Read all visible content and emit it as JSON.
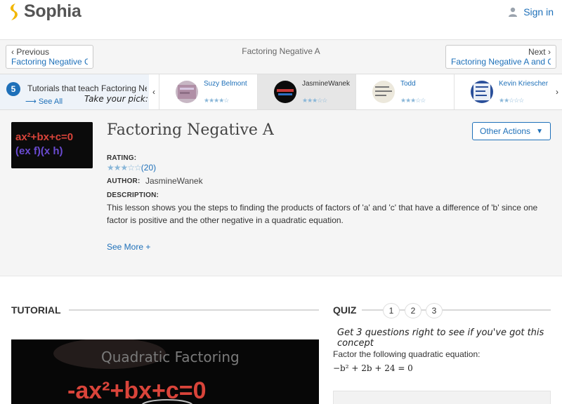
{
  "header": {
    "logo_text": "Sophia",
    "signin_label": "Sign in"
  },
  "navigation": {
    "prev_dir": "Previous",
    "prev_title": "Factoring Negative C",
    "current_title": "Factoring Negative A",
    "next_dir": "Next",
    "next_title": "Factoring Negative A and C"
  },
  "tutorial_strip": {
    "count": "5",
    "label": "Tutorials that teach Factoring Negative A",
    "see_all": "See All",
    "pick_text": "Take your pick:",
    "tutors": [
      {
        "name": "Suzy Belmont",
        "stars": "★★★★☆"
      },
      {
        "name": "JasmineWanek",
        "stars": "★★★☆☆"
      },
      {
        "name": "Todd",
        "stars": "★★★☆☆"
      },
      {
        "name": "Kevin Kriescher",
        "stars": "★★☆☆☆"
      }
    ]
  },
  "lesson": {
    "title": "Factoring Negative A",
    "more_actions": "Other Actions",
    "rating_label": "RATING:",
    "rating_stars": "★★★☆☆",
    "rating_count": "(20)",
    "author_label": "AUTHOR:",
    "author": "JasmineWanek",
    "description_label": "DESCRIPTION:",
    "description": "This lesson shows you the steps to finding the products of factors of 'a' and 'c' that have a difference of 'b' since one factor is positive and the other negative in a quadratic equation.",
    "see_more": "See More +",
    "thumb_line1": "ax²+bx+c=0",
    "thumb_line2": "(ex f)(x h)"
  },
  "tutorial_section": {
    "heading": "TUTORIAL",
    "video_text1": "Quadratic Factoring",
    "video_text2": "-ax²+bx+c=0"
  },
  "quiz": {
    "heading": "QUIZ",
    "numbers": [
      "1",
      "2",
      "3"
    ],
    "prompt": "Get 3 questions right to see if you've got this concept",
    "question": "Factor the following quadratic equation:",
    "equation": "−b² + 2b + 24 = 0"
  }
}
